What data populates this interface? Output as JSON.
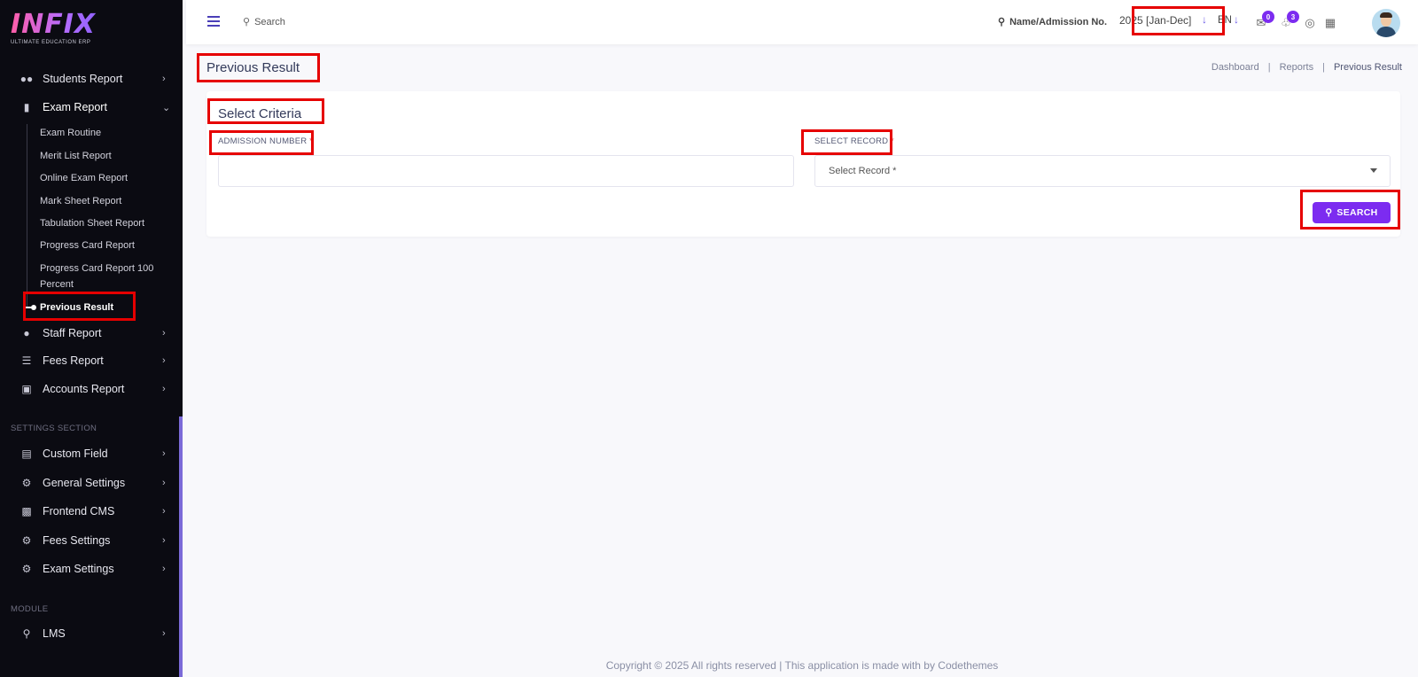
{
  "logo": {
    "text": "INFIX",
    "subtitle": "ULTIMATE EDUCATION ERP"
  },
  "sidebar": {
    "items_top": [
      {
        "label": "Students Report",
        "icon": "users-icon"
      },
      {
        "label": "Exam Report",
        "icon": "book-icon"
      }
    ],
    "exam_sub_items": [
      "Exam Routine",
      "Merit List Report",
      "Online Exam Report",
      "Mark Sheet Report",
      "Tabulation Sheet Report",
      "Progress Card Report",
      "Progress Card Report 100 Percent",
      "Previous Result"
    ],
    "items_reports": [
      {
        "label": "Staff Report",
        "icon": "user-cog-icon"
      },
      {
        "label": "Fees Report",
        "icon": "server-icon"
      },
      {
        "label": "Accounts Report",
        "icon": "money-icon"
      }
    ],
    "settings_section_title": "SETTINGS SECTION",
    "settings_items": [
      {
        "label": "Custom Field",
        "icon": "bed-icon"
      },
      {
        "label": "General Settings",
        "icon": "gears-icon"
      },
      {
        "label": "Frontend CMS",
        "icon": "monitor-icon"
      },
      {
        "label": "Fees Settings",
        "icon": "gears-icon"
      },
      {
        "label": "Exam Settings",
        "icon": "gears-icon"
      }
    ],
    "module_section_title": "MODULE",
    "module_items": [
      {
        "label": "LMS",
        "icon": "flask-icon"
      }
    ]
  },
  "topbar": {
    "search_label": "Search",
    "name_search_label": "Name/Admission No.",
    "year": "2025 [Jan-Dec]",
    "language": "EN",
    "messages_count": "0",
    "notifications_count": "3"
  },
  "page": {
    "title": "Previous Result",
    "breadcrumb": [
      "Dashboard",
      "Reports",
      "Previous Result"
    ]
  },
  "form": {
    "title": "Select Criteria",
    "admission_label": "ADMISSION NUMBER",
    "admission_value": "",
    "record_label": "SELECT RECORD",
    "record_selected": "Select Record *",
    "required_mark": "*",
    "search_button": "SEARCH"
  },
  "footer": {
    "text": "Copyright © 2025 All rights reserved | This application is made with by Codethemes"
  },
  "colors": {
    "accent": "#7c2cf0",
    "sidebar_bg": "#0b0b12",
    "highlight": "#e60000"
  }
}
